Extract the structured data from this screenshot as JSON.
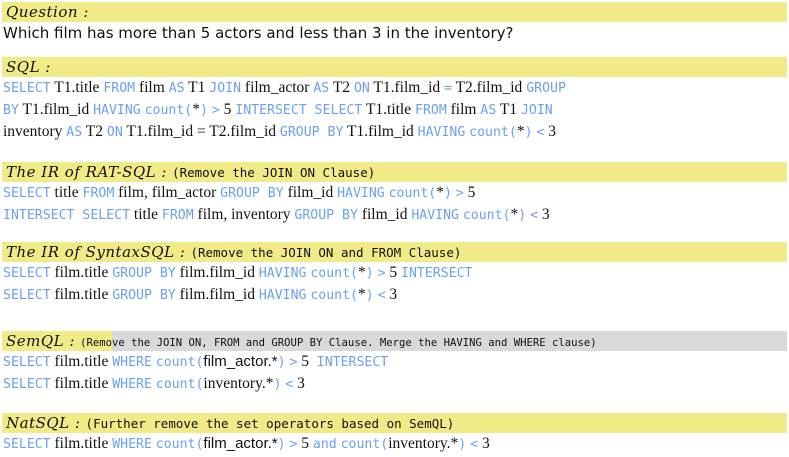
{
  "sections": [
    {
      "label": "Question :",
      "note": "",
      "lines": [
        [
          {
            "t": "Which film has more than 5 actors and less than 3 in the inventory?",
            "k": "plain"
          }
        ]
      ]
    },
    {
      "label": "SQL :",
      "note": "",
      "lines": [
        [
          {
            "t": "SELECT",
            "k": "kw"
          },
          {
            "t": " T1.title ",
            "k": "tx"
          },
          {
            "t": "FROM",
            "k": "kw"
          },
          {
            "t": " film ",
            "k": "tx"
          },
          {
            "t": "AS",
            "k": "kw"
          },
          {
            "t": " T1 ",
            "k": "tx"
          },
          {
            "t": "JOIN",
            "k": "kw"
          },
          {
            "t": " film_actor ",
            "k": "tx"
          },
          {
            "t": "AS",
            "k": "kw"
          },
          {
            "t": " T2 ",
            "k": "tx"
          },
          {
            "t": "ON",
            "k": "kw"
          },
          {
            "t": " T1.film_id ",
            "k": "tx"
          },
          {
            "t": "=",
            "k": "kw"
          },
          {
            "t": " T2.film_id ",
            "k": "tx"
          },
          {
            "t": "GROUP",
            "k": "kw"
          }
        ],
        [
          {
            "t": "BY",
            "k": "kw"
          },
          {
            "t": " T1.film_id ",
            "k": "tx"
          },
          {
            "t": "HAVING",
            "k": "kw"
          },
          {
            "t": " ",
            "k": "tx"
          },
          {
            "t": "count(",
            "k": "kw"
          },
          {
            "t": "*",
            "k": "tx"
          },
          {
            "t": ")",
            "k": "kw"
          },
          {
            "t": " ",
            "k": "tx"
          },
          {
            "t": ">",
            "k": "kw"
          },
          {
            "t": " 5 ",
            "k": "tx"
          },
          {
            "t": "INTERSECT SELECT",
            "k": "kw"
          },
          {
            "t": " T1.title ",
            "k": "tx"
          },
          {
            "t": "FROM",
            "k": "kw"
          },
          {
            "t": " film ",
            "k": "tx"
          },
          {
            "t": "AS",
            "k": "kw"
          },
          {
            "t": " T1 ",
            "k": "tx"
          },
          {
            "t": "JOIN",
            "k": "kw"
          }
        ],
        [
          {
            "t": "inventory ",
            "k": "tx"
          },
          {
            "t": "AS",
            "k": "kw"
          },
          {
            "t": " T2 ",
            "k": "tx"
          },
          {
            "t": "ON",
            "k": "kw"
          },
          {
            "t": " T1.film_id = T2.film_id ",
            "k": "tx"
          },
          {
            "t": "GROUP BY",
            "k": "kw"
          },
          {
            "t": " T1.film_id ",
            "k": "tx"
          },
          {
            "t": "HAVING",
            "k": "kw"
          },
          {
            "t": " ",
            "k": "tx"
          },
          {
            "t": "count(",
            "k": "kw"
          },
          {
            "t": "*",
            "k": "tx"
          },
          {
            "t": ")",
            "k": "kw"
          },
          {
            "t": " ",
            "k": "tx"
          },
          {
            "t": "<",
            "k": "kw"
          },
          {
            "t": " 3",
            "k": "tx"
          }
        ]
      ]
    },
    {
      "label": "The IR of RAT-SQL :",
      "note": "(Remove the JOIN ON Clause)",
      "lines": [
        [
          {
            "t": "SELECT",
            "k": "kw"
          },
          {
            "t": " title ",
            "k": "tx"
          },
          {
            "t": "FROM",
            "k": "kw"
          },
          {
            "t": " film, film_actor ",
            "k": "tx"
          },
          {
            "t": "GROUP BY",
            "k": "kw"
          },
          {
            "t": " film_id ",
            "k": "tx"
          },
          {
            "t": "HAVING",
            "k": "kw"
          },
          {
            "t": " ",
            "k": "tx"
          },
          {
            "t": "count(",
            "k": "kw"
          },
          {
            "t": "*",
            "k": "tx"
          },
          {
            "t": ")",
            "k": "kw"
          },
          {
            "t": " ",
            "k": "tx"
          },
          {
            "t": ">",
            "k": "kw"
          },
          {
            "t": " 5",
            "k": "tx"
          }
        ],
        [
          {
            "t": "INTERSECT SELECT",
            "k": "kw"
          },
          {
            "t": " title ",
            "k": "tx"
          },
          {
            "t": "FROM",
            "k": "kw"
          },
          {
            "t": " film, inventory ",
            "k": "tx"
          },
          {
            "t": "GROUP BY",
            "k": "kw"
          },
          {
            "t": " film_id ",
            "k": "tx"
          },
          {
            "t": "HAVING",
            "k": "kw"
          },
          {
            "t": " ",
            "k": "tx"
          },
          {
            "t": "count(",
            "k": "kw"
          },
          {
            "t": "*",
            "k": "tx"
          },
          {
            "t": ")",
            "k": "kw"
          },
          {
            "t": " ",
            "k": "tx"
          },
          {
            "t": "<",
            "k": "kw"
          },
          {
            "t": " 3",
            "k": "tx"
          }
        ]
      ]
    },
    {
      "label": "The IR of SyntaxSQL :",
      "note": "(Remove the JOIN ON and FROM Clause)",
      "lines": [
        [
          {
            "t": "SELECT",
            "k": "kw"
          },
          {
            "t": " film.title ",
            "k": "tx"
          },
          {
            "t": "GROUP BY",
            "k": "kw"
          },
          {
            "t": " film.film_id ",
            "k": "tx"
          },
          {
            "t": "HAVING",
            "k": "kw"
          },
          {
            "t": " ",
            "k": "tx"
          },
          {
            "t": "count(",
            "k": "kw"
          },
          {
            "t": "*",
            "k": "tx"
          },
          {
            "t": ")",
            "k": "kw"
          },
          {
            "t": " ",
            "k": "tx"
          },
          {
            "t": ">",
            "k": "kw"
          },
          {
            "t": " 5 ",
            "k": "tx"
          },
          {
            "t": "INTERSECT",
            "k": "kw"
          }
        ],
        [
          {
            "t": "SELECT",
            "k": "kw"
          },
          {
            "t": " film.title ",
            "k": "tx"
          },
          {
            "t": "GROUP BY",
            "k": "kw"
          },
          {
            "t": " film.film_id ",
            "k": "tx"
          },
          {
            "t": "HAVING",
            "k": "kw"
          },
          {
            "t": " ",
            "k": "tx"
          },
          {
            "t": "count(",
            "k": "kw"
          },
          {
            "t": "*",
            "k": "tx"
          },
          {
            "t": ")",
            "k": "kw"
          },
          {
            "t": " ",
            "k": "tx"
          },
          {
            "t": "<",
            "k": "kw"
          },
          {
            "t": " 3",
            "k": "tx"
          }
        ]
      ]
    },
    {
      "label": "SemQL :",
      "note": "(Remove the JOIN ON, FROM and GROUP BY Clause. Merge the HAVING and WHERE clause)",
      "lines": [
        [
          {
            "t": "SELECT",
            "k": "kw"
          },
          {
            "t": " film.title ",
            "k": "tx"
          },
          {
            "t": "WHERE",
            "k": "kw"
          },
          {
            "t": " ",
            "k": "tx"
          },
          {
            "t": "count(",
            "k": "kw"
          },
          {
            "t": "film_actor.*",
            "k": "tx2"
          },
          {
            "t": ")",
            "k": "kw"
          },
          {
            "t": " ",
            "k": "tx"
          },
          {
            "t": ">",
            "k": "kw"
          },
          {
            "t": " 5  ",
            "k": "tx"
          },
          {
            "t": "INTERSECT",
            "k": "kw"
          }
        ],
        [
          {
            "t": "SELECT",
            "k": "kw"
          },
          {
            "t": " film.title ",
            "k": "tx"
          },
          {
            "t": "WHERE",
            "k": "kw"
          },
          {
            "t": " ",
            "k": "tx"
          },
          {
            "t": "count(",
            "k": "kw"
          },
          {
            "t": "inventory.*",
            "k": "tx"
          },
          {
            "t": ")",
            "k": "kw"
          },
          {
            "t": " ",
            "k": "tx"
          },
          {
            "t": "<",
            "k": "kw"
          },
          {
            "t": " 3",
            "k": "tx"
          }
        ]
      ]
    },
    {
      "label": "NatSQL :",
      "note": "(Further remove the set operators based on SemQL)",
      "lines": [
        [
          {
            "t": "SELECT",
            "k": "kw"
          },
          {
            "t": " film.title ",
            "k": "tx"
          },
          {
            "t": "WHERE",
            "k": "kw"
          },
          {
            "t": " ",
            "k": "tx"
          },
          {
            "t": "count(",
            "k": "kw"
          },
          {
            "t": "film_actor.*",
            "k": "tx2"
          },
          {
            "t": ")",
            "k": "kw"
          },
          {
            "t": " ",
            "k": "tx"
          },
          {
            "t": ">",
            "k": "kw"
          },
          {
            "t": " 5 ",
            "k": "tx"
          },
          {
            "t": "and",
            "k": "kw"
          },
          {
            "t": " ",
            "k": "tx"
          },
          {
            "t": "count(",
            "k": "kw"
          },
          {
            "t": "inventory.*",
            "k": "tx"
          },
          {
            "t": ")",
            "k": "kw"
          },
          {
            "t": " ",
            "k": "tx"
          },
          {
            "t": "<",
            "k": "kw"
          },
          {
            "t": " 3",
            "k": "tx"
          }
        ]
      ]
    }
  ]
}
